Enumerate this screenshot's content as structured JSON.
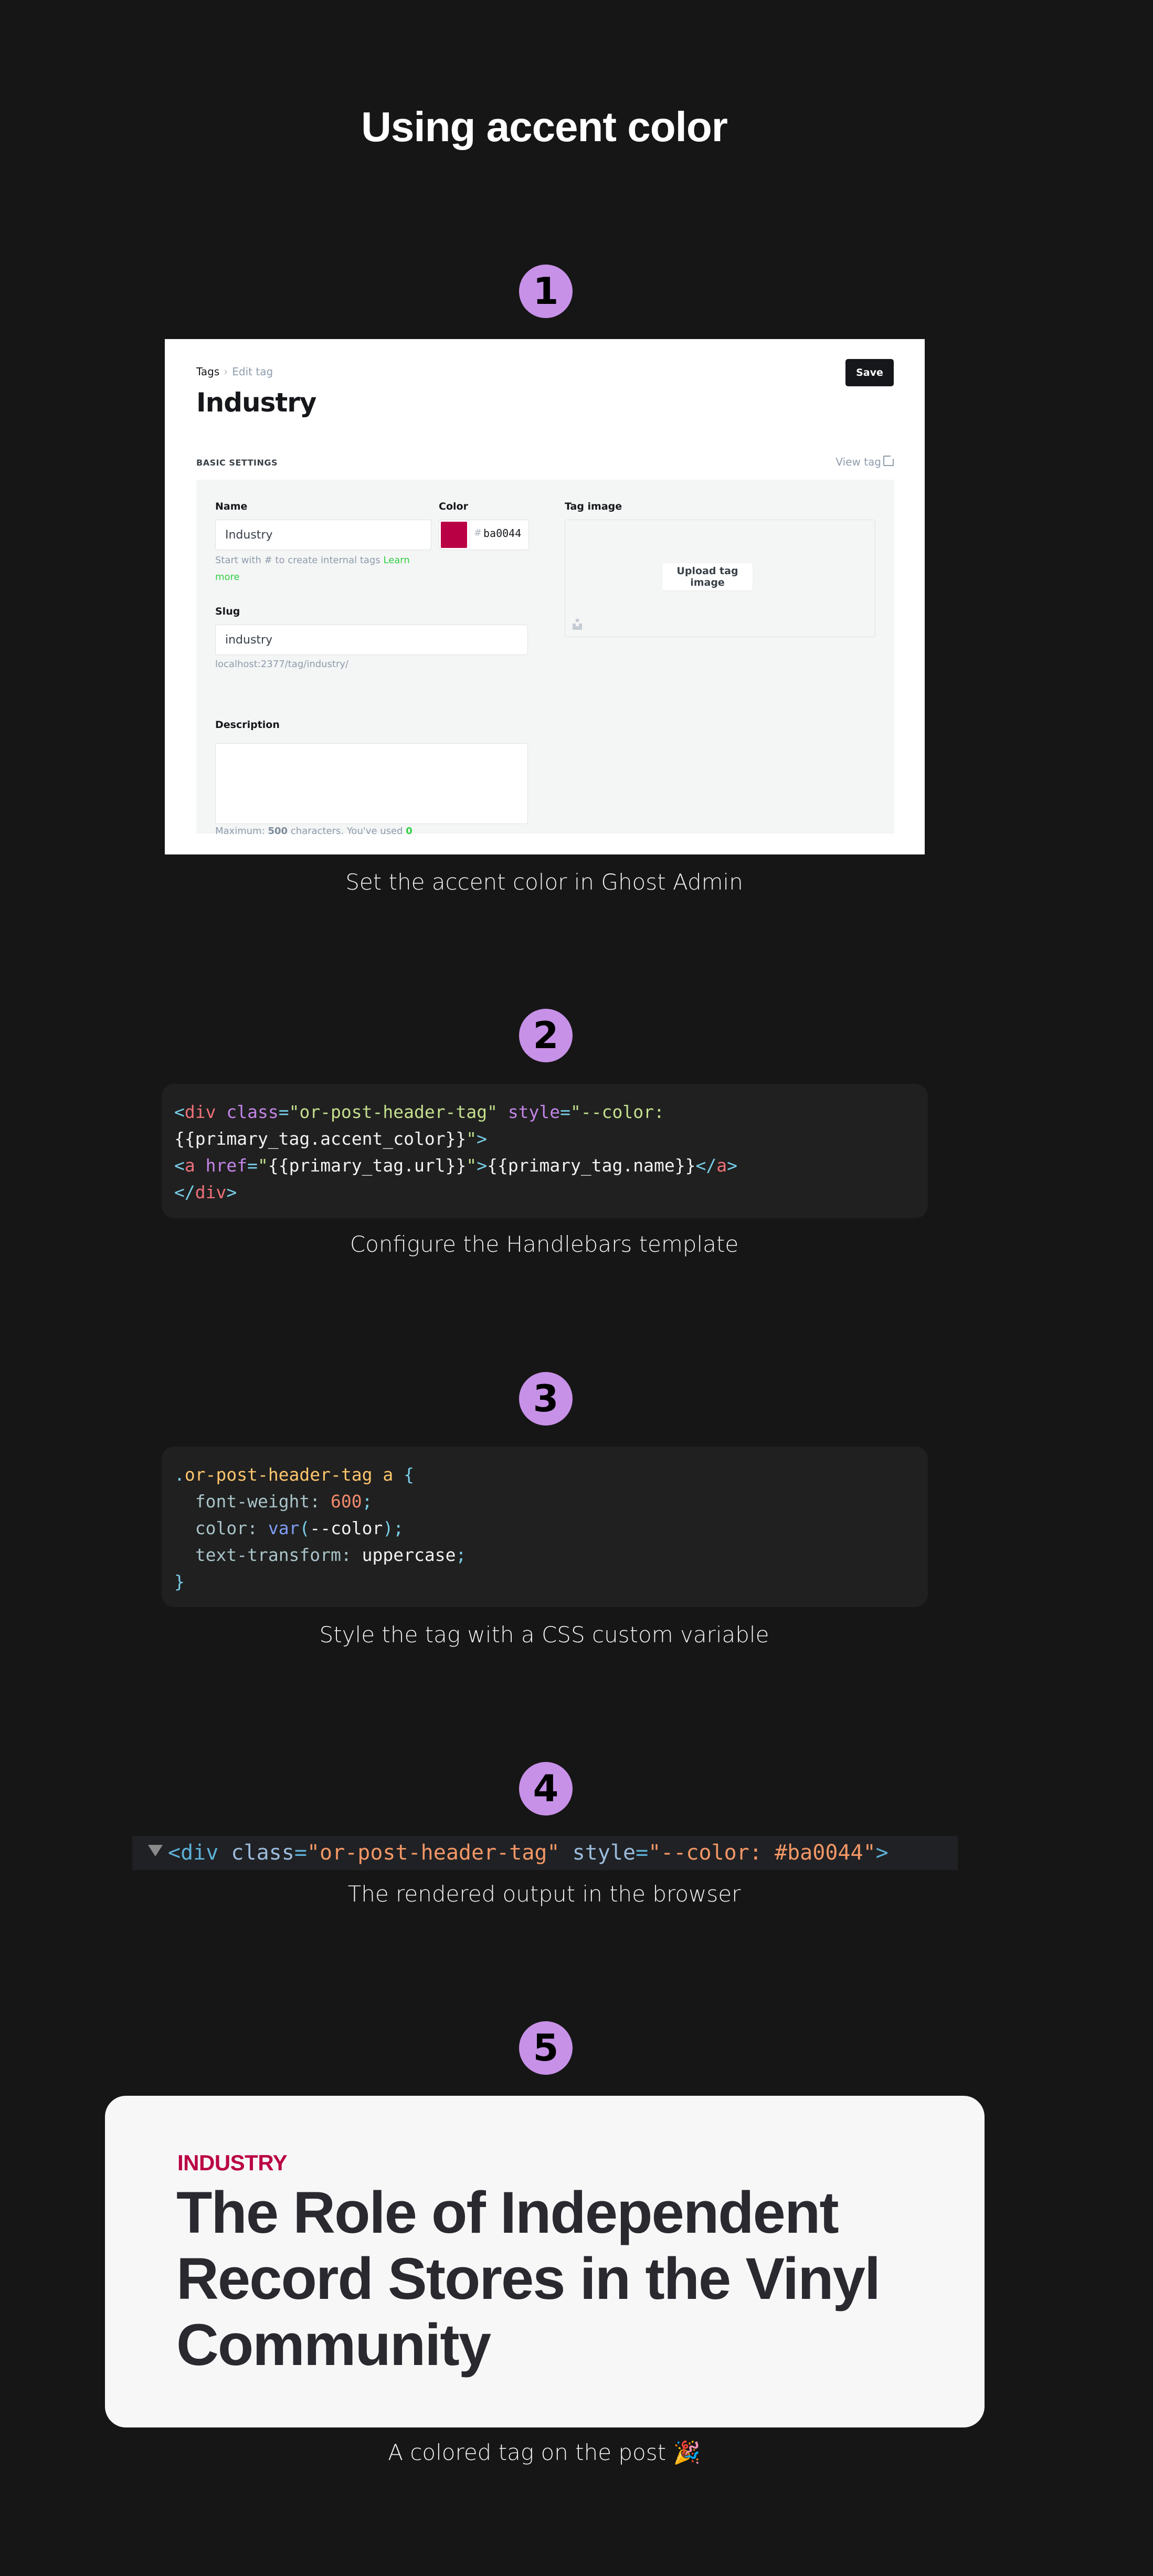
{
  "page": {
    "title": "Using accent color"
  },
  "steps": [
    {
      "number": "1",
      "caption": "Set the accent color in Ghost Admin"
    },
    {
      "number": "2",
      "caption": "Configure the Handlebars template"
    },
    {
      "number": "3",
      "caption": "Style the tag with a CSS custom variable"
    },
    {
      "number": "4",
      "caption": "The rendered output in the browser"
    },
    {
      "number": "5",
      "caption": "A colored tag on the post 🎉"
    }
  ],
  "colors": {
    "background": "#161616",
    "step_badge": "#c791e8",
    "accent": "#ba0044"
  },
  "admin": {
    "breadcrumb": {
      "parent": "Tags",
      "separator": "›",
      "current": "Edit tag"
    },
    "heading": "Industry",
    "save_label": "Save",
    "section_label": "BASIC SETTINGS",
    "view_tag_label": "View tag",
    "name": {
      "label": "Name",
      "value": "Industry"
    },
    "name_hint": "Start with # to create internal tags",
    "name_hint_link": "Learn more",
    "color": {
      "label": "Color",
      "hash": "#",
      "value": "ba0044",
      "swatch": "#ba0044"
    },
    "slug": {
      "label": "Slug",
      "value": "industry"
    },
    "slug_url": "localhost:2377/tag/industry/",
    "description": {
      "label": "Description",
      "value": ""
    },
    "desc_hint_prefix": "Maximum:",
    "desc_hint_max": "500",
    "desc_hint_mid": "characters. You've used",
    "desc_hint_used": "0",
    "tag_image": {
      "label": "Tag image",
      "button": "Upload tag image"
    }
  },
  "handlebars_code": {
    "l1_open": "<",
    "l1_tag": "div",
    "l1_attr1": "class",
    "l1_eq1": "=",
    "l1_val1": "\"or-post-header-tag\"",
    "l1_attr2": "style",
    "l1_eq2": "=",
    "l1_val2": "\"--color:",
    "l2_text": "{{primary_tag.accent_color}}",
    "l2_quote": "\"",
    "l2_close": ">",
    "l3_open": "<",
    "l3_tag": "a",
    "l3_attr": "href",
    "l3_eq": "=",
    "l3_q1": "\"",
    "l3_val": "{{primary_tag.url}}",
    "l3_q2": "\"",
    "l3_gt": ">",
    "l3_text": "{{primary_tag.name}}",
    "l3_close_open": "</",
    "l3_close_tag": "a",
    "l3_close_gt": ">",
    "l4_open": "</",
    "l4_tag": "div",
    "l4_gt": ">"
  },
  "css_code": {
    "selector_dot": ".",
    "selector": "or-post-header-tag a",
    "brace_open": "{",
    "prop1": "font-weight:",
    "val1": "600",
    "semi": ";",
    "prop2": "color:",
    "fn": "var",
    "paren_open": "(",
    "var_name": "--color",
    "paren_close": ")",
    "prop3": "text-transform:",
    "val3": "uppercase",
    "brace_close": "}"
  },
  "devtools": {
    "tag_open": "<div",
    "attr1": "class",
    "eq": "=",
    "val1": "\"or-post-header-tag\"",
    "attr2": "style",
    "val2": "\"--color: #ba0044\"",
    "tag_close": ">"
  },
  "post": {
    "tag": "INDUSTRY",
    "title": "The Role of Independent Record Stores in the Vinyl Community"
  }
}
